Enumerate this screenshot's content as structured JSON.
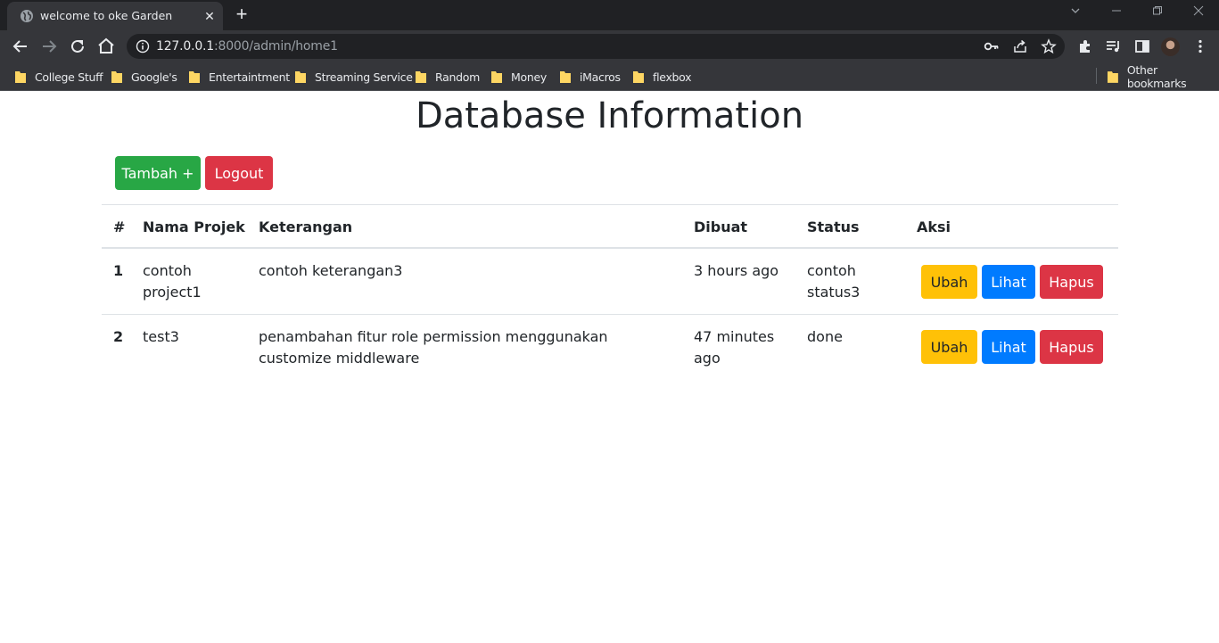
{
  "browser": {
    "tab_title": "welcome to oke Garden",
    "url_host": "127.0.0.1",
    "url_path": ":8000/admin/home1",
    "bookmarks": [
      "College Stuff",
      "Google's",
      "Entertaintment",
      "Streaming Service",
      "Random",
      "Money",
      "iMacros",
      "flexbox"
    ],
    "other_bookmarks": "Other bookmarks"
  },
  "page": {
    "title": "Database Information",
    "add_button": "Tambah +",
    "logout_button": "Logout",
    "columns": [
      "#",
      "Nama Projek",
      "Keterangan",
      "Dibuat",
      "Status",
      "Aksi"
    ],
    "rows": [
      {
        "no": "1",
        "nama": "contoh project1",
        "keterangan": "contoh keterangan3",
        "dibuat": "3 hours ago",
        "status": "contoh status3"
      },
      {
        "no": "2",
        "nama": "test3",
        "keterangan": "penambahan fitur role permission menggunakan customize middleware",
        "dibuat": "47 minutes ago",
        "status": "done"
      }
    ],
    "actions": {
      "edit": "Ubah",
      "view": "Lihat",
      "delete": "Hapus"
    }
  },
  "colors": {
    "success": "#28a745",
    "danger": "#dc3545",
    "warning": "#ffc107",
    "primary": "#007bff"
  }
}
